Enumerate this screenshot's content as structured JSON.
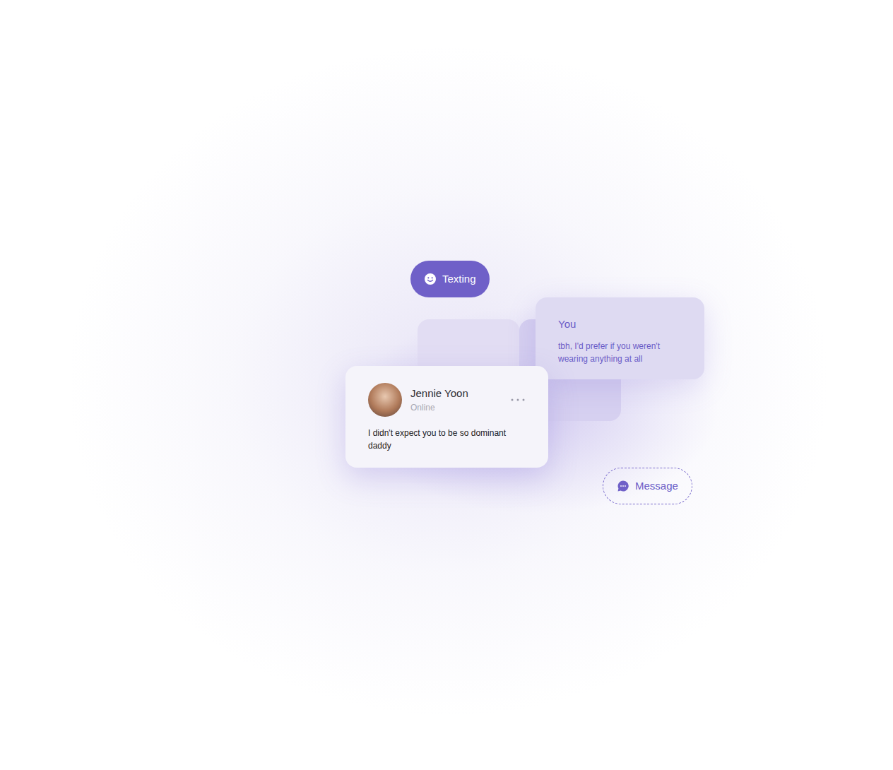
{
  "pill": {
    "label": "Texting"
  },
  "reply": {
    "sender": "You",
    "text": "tbh, I'd prefer if you weren't wearing anything at all"
  },
  "chat": {
    "name": "Jennie Yoon",
    "status": "Online",
    "message": "I didn't expect you to be so dominant daddy"
  },
  "message_button": {
    "label": "Message"
  }
}
